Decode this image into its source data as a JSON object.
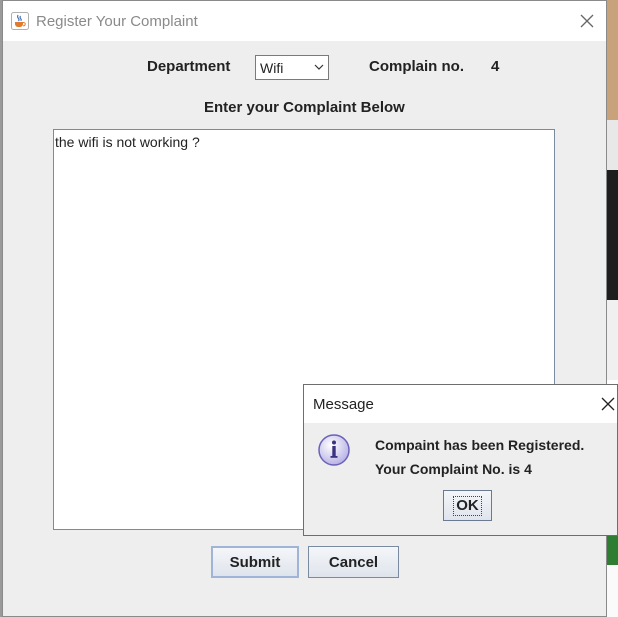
{
  "window": {
    "title": "Register Your Complaint",
    "icon": "java-cup-icon"
  },
  "form": {
    "department_label": "Department",
    "department_value": "Wifi",
    "complain_no_label": "Complain no.",
    "complain_no_value": "4",
    "enter_label": "Enter your Complaint Below",
    "complaint_text": "the wifi is not working ?"
  },
  "buttons": {
    "submit": "Submit",
    "cancel": "Cancel"
  },
  "dialog": {
    "title": "Message",
    "line1": "Compaint has been Registered.",
    "line2": "Your Complaint No. is 4",
    "ok": "OK",
    "icon": "info-icon"
  }
}
